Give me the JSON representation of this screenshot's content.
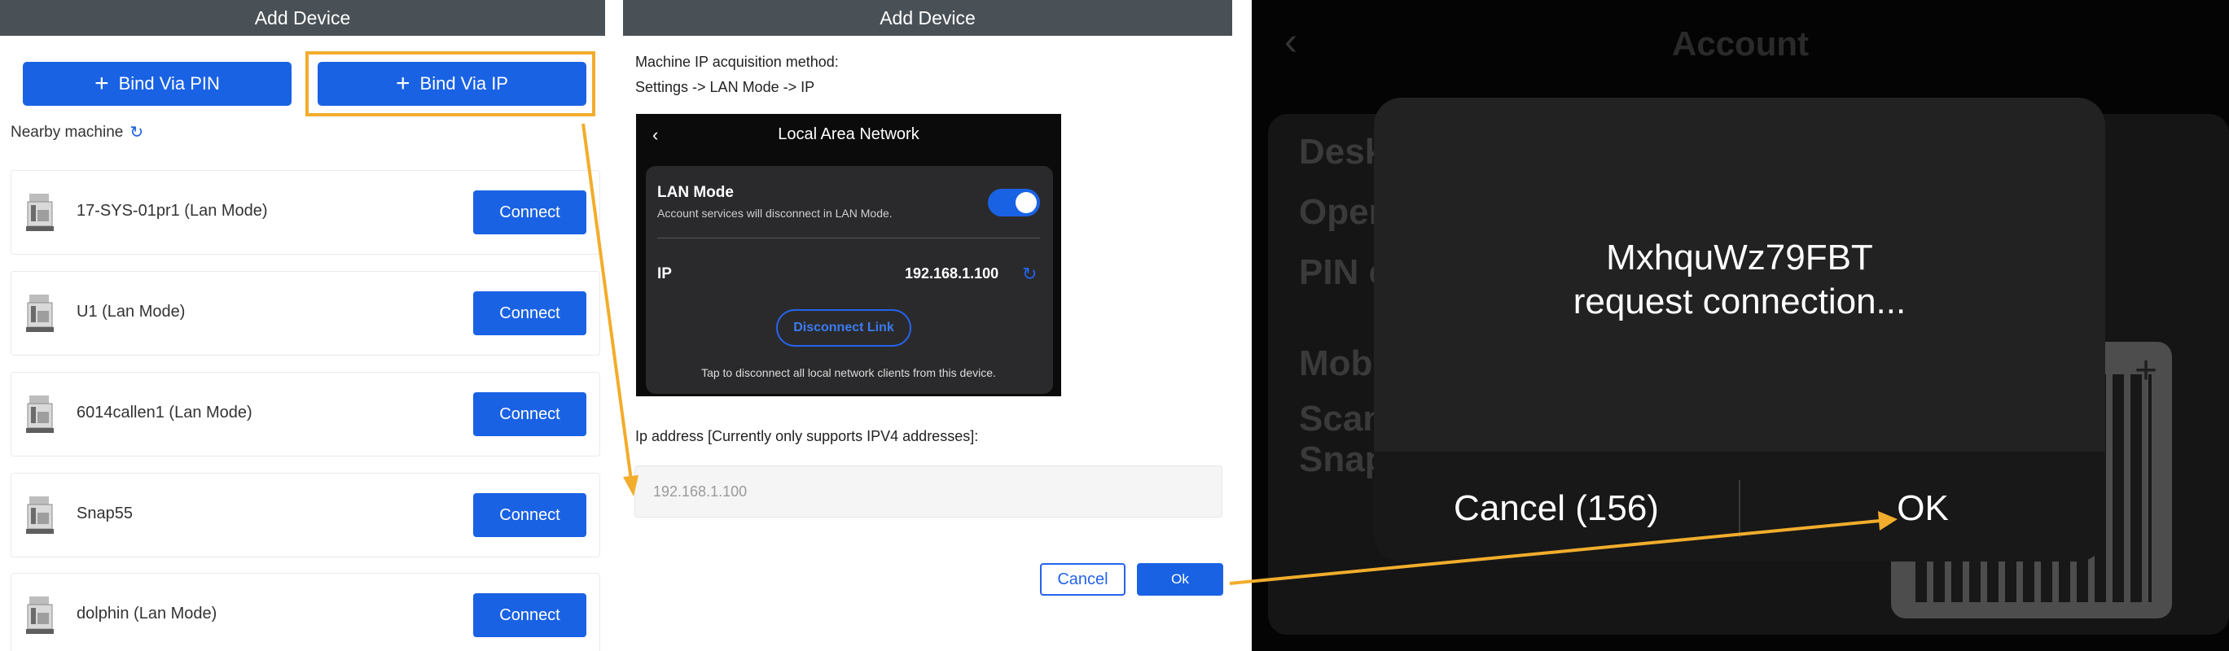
{
  "panel1": {
    "title": "Add Device",
    "bind_pin_label": "Bind Via PIN",
    "bind_ip_label": "Bind Via IP",
    "nearby_label": "Nearby machine",
    "connect_label": "Connect",
    "devices": [
      {
        "name": "17-SYS-01pr1 (Lan Mode)"
      },
      {
        "name": "U1 (Lan Mode)"
      },
      {
        "name": "6014callen1 (Lan Mode)"
      },
      {
        "name": "Snap55"
      },
      {
        "name": "dolphin (Lan Mode)"
      }
    ]
  },
  "panel2": {
    "title": "Add Device",
    "method_line1": "Machine IP acquisition method:",
    "method_line2": "Settings -> LAN Mode -> IP",
    "screenshot": {
      "header": "Local Area Network",
      "lan_mode": "LAN Mode",
      "lan_sub": "Account services will disconnect in LAN Mode.",
      "ip_label": "IP",
      "ip_value": "192.168.1.100",
      "disconnect_label": "Disconnect Link",
      "footer": "Tap to disconnect all local network clients from this device."
    },
    "ip_prompt": "Ip address [Currently only supports IPV4 addresses]:",
    "ip_placeholder": "192.168.1.100",
    "cancel_label": "Cancel",
    "ok_label": "Ok"
  },
  "panel3": {
    "header": "Account",
    "dialog_name": "MxhquWz79FBT",
    "dialog_message": "request connection...",
    "cancel_label": "Cancel (156)",
    "ok_label": "OK",
    "bg_lines": [
      "Desk",
      "Oper",
      "PIN c",
      "Mob",
      "Scan",
      "Snap"
    ]
  },
  "annotation": {
    "color": "#f2ad2c"
  }
}
